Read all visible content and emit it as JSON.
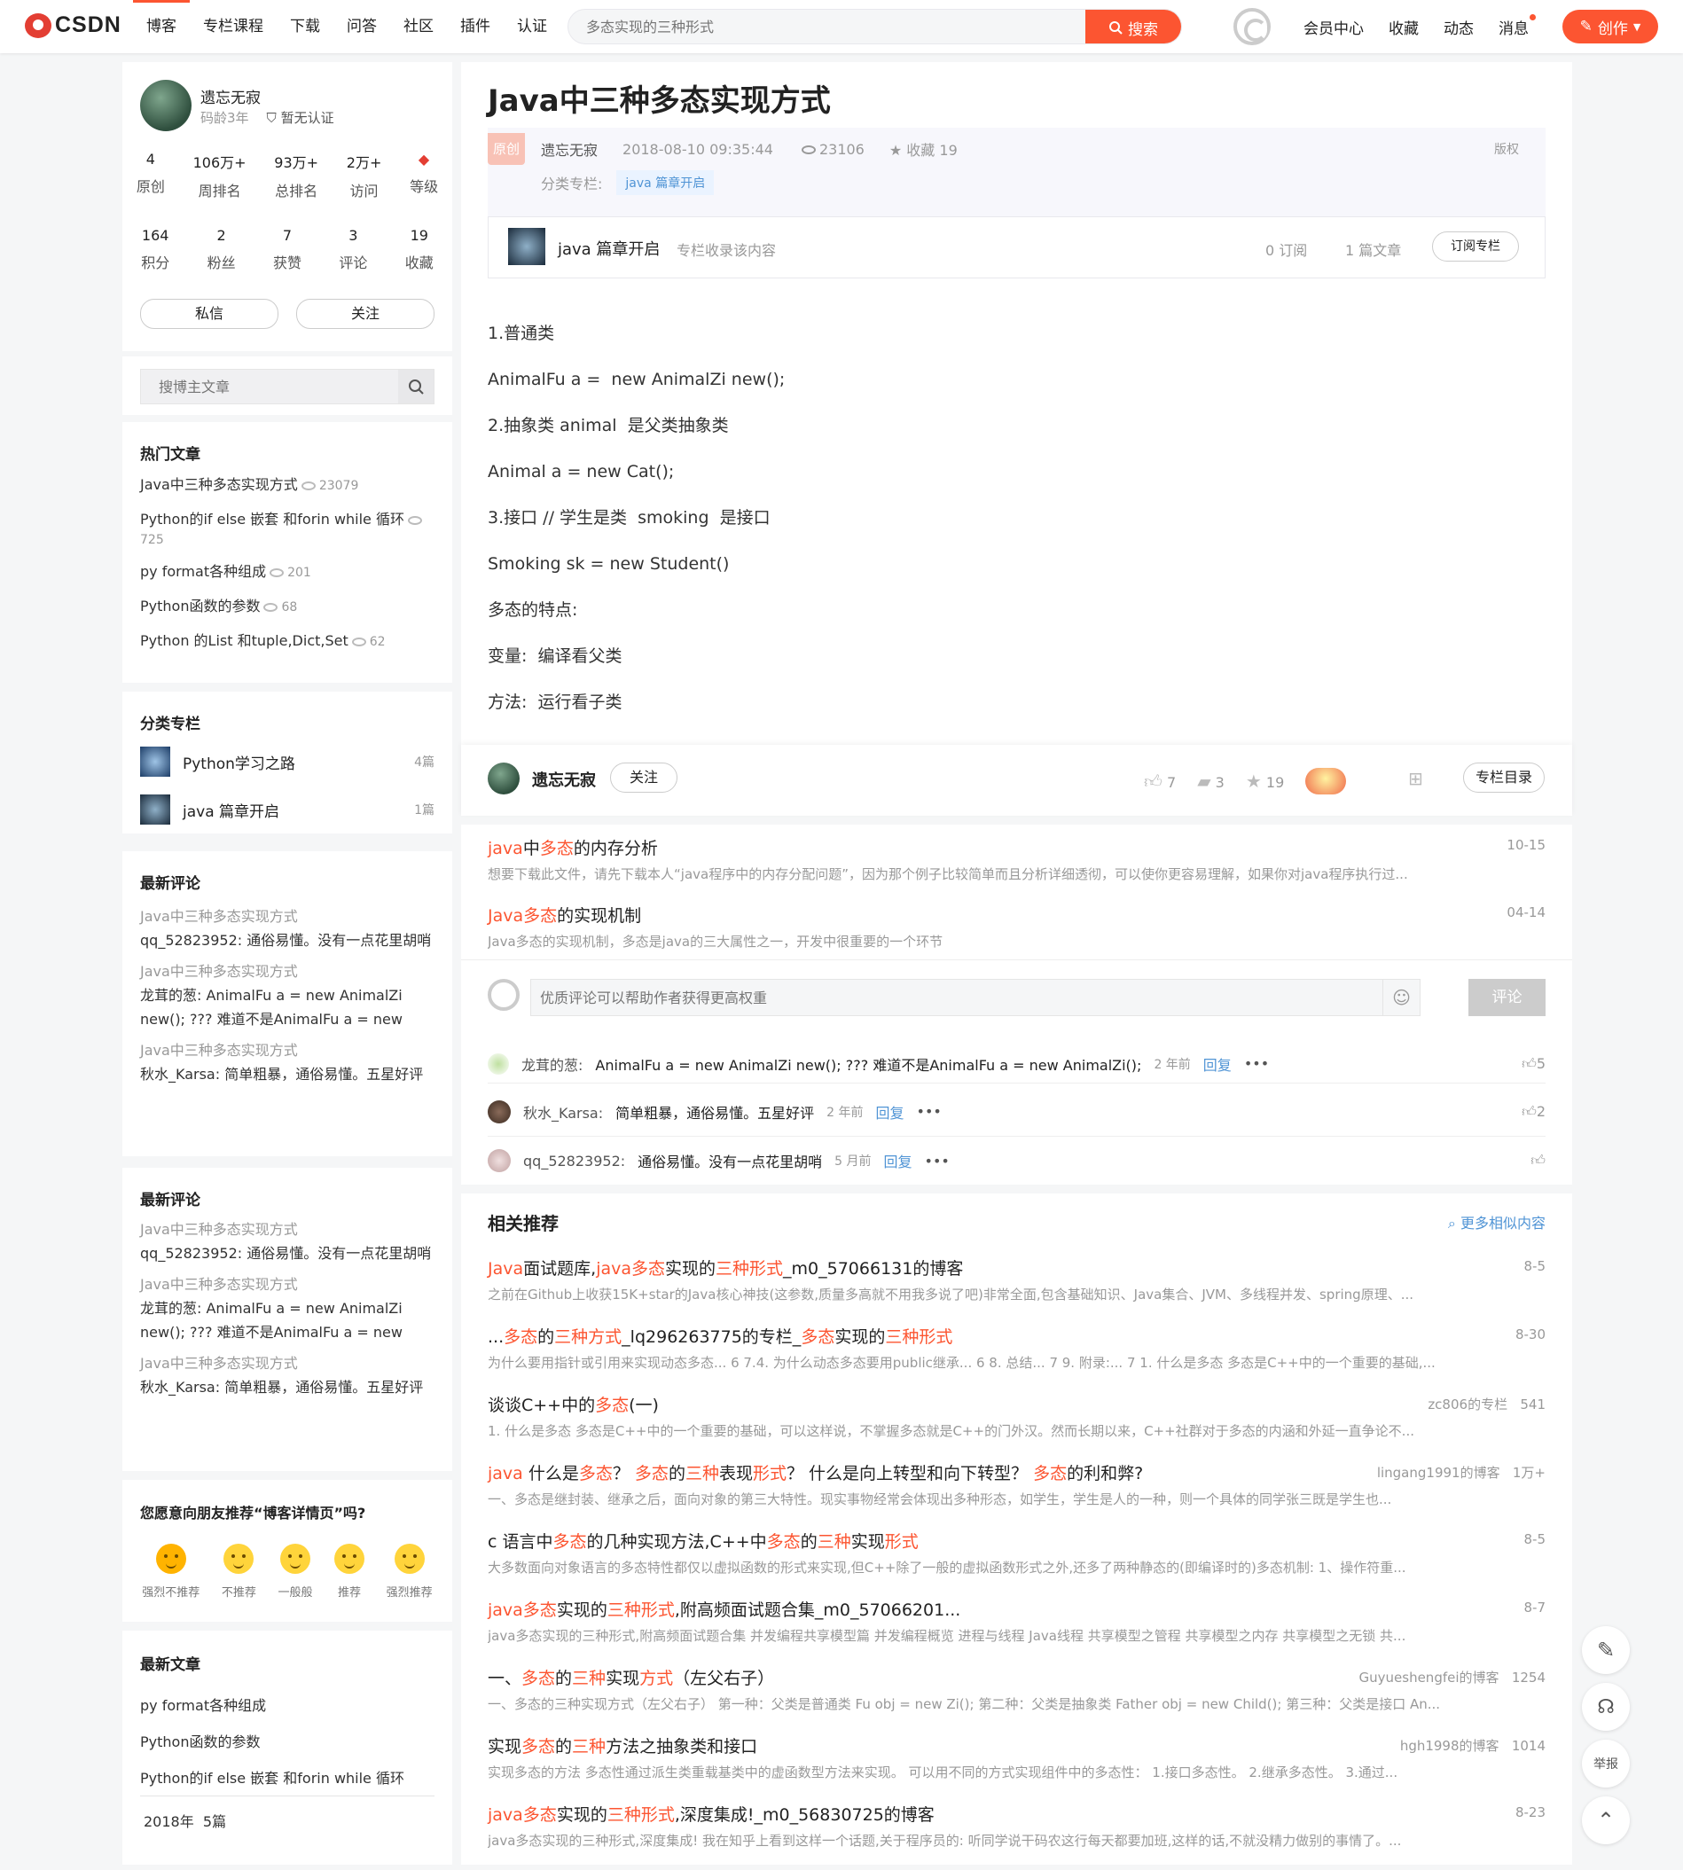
{
  "header": {
    "logo": "CSDN",
    "nav": [
      "博客",
      "专栏课程",
      "下载",
      "问答",
      "社区",
      "插件",
      "认证"
    ],
    "search_placeholder": "多态实现的三种形式",
    "search_btn": "搜索",
    "links": [
      "会员中心",
      "收藏",
      "动态",
      "消息"
    ],
    "create": "创作"
  },
  "profile": {
    "name": "遗忘无寂",
    "age": "码龄3年",
    "cert": "暂无认证",
    "stats1": [
      {
        "n": "4",
        "l": "原创"
      },
      {
        "n": "106万+",
        "l": "周排名"
      },
      {
        "n": "93万+",
        "l": "总排名"
      },
      {
        "n": "2万+",
        "l": "访问"
      },
      {
        "n": "",
        "l": "等级"
      }
    ],
    "stats2": [
      {
        "n": "164",
        "l": "积分"
      },
      {
        "n": "2",
        "l": "粉丝"
      },
      {
        "n": "7",
        "l": "获赞"
      },
      {
        "n": "3",
        "l": "评论"
      },
      {
        "n": "19",
        "l": "收藏"
      }
    ],
    "msg_btn": "私信",
    "follow_btn": "关注"
  },
  "side_search": {
    "placeholder": "搜博主文章"
  },
  "hot": {
    "title": "热门文章",
    "items": [
      {
        "t": "Java中三种多态实现方式",
        "v": "23079"
      },
      {
        "t": "Python的if else 嵌套 和forin while 循环",
        "v": "725"
      },
      {
        "t": "py format各种组成",
        "v": "201"
      },
      {
        "t": "Python函数的参数",
        "v": "68"
      },
      {
        "t": "Python 的List 和tuple,Dict,Set",
        "v": "62"
      }
    ]
  },
  "columns": {
    "title": "分类专栏",
    "items": [
      {
        "t": "Python学习之路",
        "c": "4篇"
      },
      {
        "t": "java 篇章开启",
        "c": "1篇"
      }
    ]
  },
  "comments1": {
    "title": "最新评论",
    "items": [
      {
        "a": "Java中三种多态实现方式",
        "b": "qq_52823952: 通俗易懂。没有一点花里胡哨"
      },
      {
        "a": "Java中三种多态实现方式",
        "b": "龙茸的葱: AnimalFu a = new AnimalZi new(); ??? 难道不是AnimalFu a = new Anim..."
      },
      {
        "a": "Java中三种多态实现方式",
        "b": "秋水_Karsa: 简单粗暴，通俗易懂。五星好评"
      }
    ]
  },
  "comments2": {
    "title": "最新评论",
    "items": [
      {
        "a": "Java中三种多态实现方式",
        "b": "qq_52823952: 通俗易懂。没有一点花里胡哨"
      },
      {
        "a": "Java中三种多态实现方式",
        "b": "龙茸的葱: AnimalFu a = new AnimalZi new(); ??? 难道不是AnimalFu a = new Anim..."
      },
      {
        "a": "Java中三种多态实现方式",
        "b": "秋水_Karsa: 简单粗暴，通俗易懂。五星好评"
      }
    ]
  },
  "recommend": {
    "title": "您愿意向朋友推荐“博客详情页”吗?",
    "opts": [
      "强烈不推荐",
      "不推荐",
      "一般般",
      "推荐",
      "强烈推荐"
    ]
  },
  "latest": {
    "title": "最新文章",
    "items": [
      "py format各种组成",
      "Python函数的参数",
      "Python的if else 嵌套 和forin while 循环"
    ],
    "archive": "2018年  5篇"
  },
  "article": {
    "title": "Java中三种多态实现方式",
    "badge": "原创",
    "author": "遗忘无寂",
    "date": "2018-08-10 09:35:44",
    "views": "23106",
    "fav": "收藏 19",
    "copyright": "版权",
    "cat_label": "分类专栏:",
    "cat_tag": "java 篇章开启",
    "col_name": "java 篇章开启",
    "col_desc": "专栏收录该内容",
    "col_subs": "0 订阅",
    "col_count": "1 篇文章",
    "col_btn": "订阅专栏",
    "body": [
      "1.普通类",
      "AnimalFu a =  new AnimalZi new();",
      "2.抽象类 animal  是父类抽象类",
      "Animal a = new Cat();",
      "3.接口 // 学生是类  smoking  是接口",
      "Smoking sk = new Student()",
      "多态的特点:",
      "变量:  编译看父类",
      "方法:  运行看子类"
    ]
  },
  "toolbar": {
    "author": "遗忘无寂",
    "follow": "关注",
    "likes": "7",
    "comments": "3",
    "favs": "19",
    "catalog": "专栏目录"
  },
  "inline_rel": [
    {
      "t": "java中多态的内存分析",
      "d": "10-15",
      "desc": "想要下载此文件，请先下载本人“java程序中的内存分配问题”，因为那个例子比较简单而且分析详细透彻，可以使你更容易理解，如果你对java程序执行过..."
    },
    {
      "t": "Java多态的实现机制",
      "d": "04-14",
      "desc": "Java多态的实现机制，多态是java的三大属性之一，开发中很重要的一个环节"
    }
  ],
  "comment_box": {
    "placeholder": "优质评论可以帮助作者获得更高权重",
    "submit": "评论"
  },
  "comments": [
    {
      "user": "龙茸的葱:",
      "text": "AnimalFu a = new AnimalZi new(); ??? 难道不是AnimalFu a = new AnimalZi();",
      "time": "2 年前",
      "reply": "回复",
      "likes": "5"
    },
    {
      "user": "秋水_Karsa:",
      "text": "简单粗暴，通俗易懂。五星好评",
      "time": "2 年前",
      "reply": "回复",
      "likes": "2"
    },
    {
      "user": "qq_52823952:",
      "text": "通俗易懂。没有一点花里胡哨",
      "time": "5 月前",
      "reply": "回复",
      "likes": ""
    }
  ],
  "related": {
    "title": "相关推荐",
    "more": "更多相似内容",
    "items": [
      {
        "t": "Java面试题库,java多态实现的三种形式_m0_57066131的博客",
        "m": "8-5",
        "desc": "之前在Github上收获15K+star的Java核心神技(这参数,质量多高就不用我多说了吧)非常全面,包含基础知识、Java集合、JVM、多线程并发、spring原理、..."
      },
      {
        "t": "...多态的三种方式_lq296263775的专栏_多态实现的三种形式",
        "m": "8-30",
        "desc": "为什么要用指针或引用来实现动态多态... 6 7.4. 为什么动态多态要用public继承... 6 8. 总结... 7 9. 附录:... 7 1. 什么是多态 多态是C++中的一个重要的基础,..."
      },
      {
        "t": "谈谈C++中的多态(一)",
        "m": "zc806的专栏   541",
        "desc": "1.  什么是多态 多态是C++中的一个重要的基础，可以这样说，不掌握多态就是C++的门外汉。然而长期以来，C++社群对于多态的内涵和外延一直争论不..."
      },
      {
        "t": "java 什么是多态？ 多态的三种表现形式？ 什么是向上转型和向下转型？ 多态的利和弊?",
        "m": "lingang1991的博客   1万+",
        "desc": "一、多态是继封装、继承之后，面向对象的第三大特性。现实事物经常会体现出多种形态，如学生，学生是人的一种，则一个具体的同学张三既是学生也..."
      },
      {
        "t": "c 语言中多态的几种实现方法,C++中多态的三种实现形式",
        "m": "8-5",
        "desc": "大多数面向对象语言的多态特性都仅以虚拟函数的形式来实现,但C++除了一般的虚拟函数形式之外,还多了两种静态的(即编译时的)多态机制: 1、操作符重..."
      },
      {
        "t": "java多态实现的三种形式,附高频面试题合集_m0_57066201...",
        "m": "8-7",
        "desc": "java多态实现的三种形式,附高频面试题合集 并发编程共享模型篇 并发编程概览 进程与线程 Java线程 共享模型之管程 共享模型之内存 共享模型之无锁 共..."
      },
      {
        "t": "一、多态的三种实现方式（左父右子）",
        "m": "Guyueshengfei的博客   1254",
        "desc": "一、多态的三种实现方式（左父右子） 第一种：父类是普通类 Fu obj = new Zi(); 第二种：父类是抽象类 Father obj = new Child(); 第三种：父类是接口 An..."
      },
      {
        "t": "实现多态的三种方法之抽象类和接口",
        "m": "hgh1998的博客   1014",
        "desc": "实现多态的方法 多态性通过派生类重载基类中的虚函数型方法来实现。 可以用不同的方式实现组件中的多态性： 1.接口多态性。 2.继承多态性。 3.通过..."
      },
      {
        "t": "java多态实现的三种形式,深度集成!_m0_56830725的博客",
        "m": "8-23",
        "desc": "java多态实现的三种形式,深度集成! 我在知乎上看到这样一个话题,关于程序员的: 听同学说干码农这行每天都要加班,这样的话,不就没精力做别的事情了。..."
      }
    ]
  },
  "float": {
    "report": "举报"
  }
}
